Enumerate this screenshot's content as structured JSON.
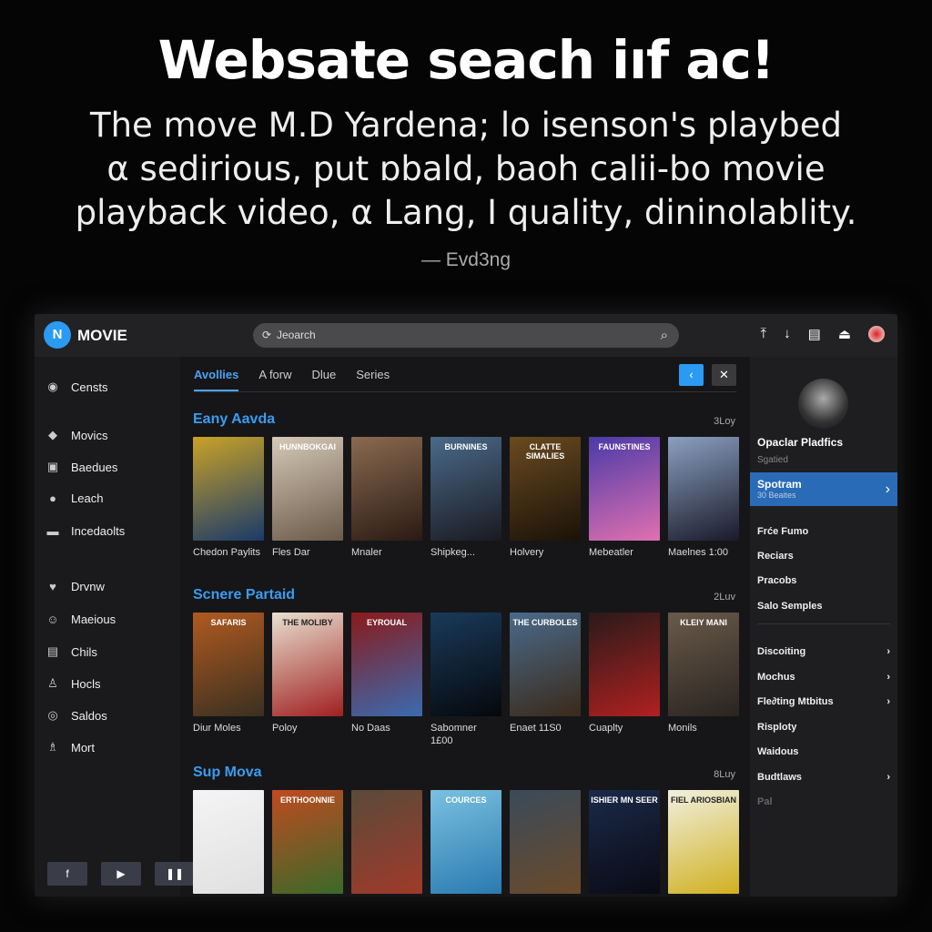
{
  "hero": {
    "title": "Websate seach iıf ac!",
    "subtitle": [
      "The move M.D Yardena; lo isenson's playbed",
      "α sedirious, put ɒbald, baoh calii-bo movie",
      "playback video, α Lang, I quality, dininolablity."
    ],
    "attribution": "— Evd3ng"
  },
  "header": {
    "logo": "N",
    "brand": "MOVIE",
    "search_placeholder": "Jeoarch",
    "icons": [
      "upload-icon",
      "download-icon",
      "list-icon",
      "cast-icon",
      "avatar"
    ]
  },
  "sidebar": {
    "items": [
      {
        "label": "Censts",
        "icon": "◉"
      },
      {
        "label": "Movics",
        "icon": "◆"
      },
      {
        "label": "Baedues",
        "icon": "▣"
      },
      {
        "label": "Leach",
        "icon": "●"
      },
      {
        "label": "Incedaolts",
        "icon": "▬"
      },
      {
        "label": "Drvnw",
        "icon": "♥"
      },
      {
        "label": "Maeious",
        "icon": "☺"
      },
      {
        "label": "Chils",
        "icon": "▤"
      },
      {
        "label": "Hocls",
        "icon": "♙"
      },
      {
        "label": "Saldos",
        "icon": "◎"
      },
      {
        "label": "Mort",
        "icon": "♗"
      }
    ],
    "buttons": [
      "f",
      "▶",
      "❚❚"
    ]
  },
  "tabs": [
    {
      "label": "Avollies",
      "active": true
    },
    {
      "label": "A forw"
    },
    {
      "label": "Dlue"
    },
    {
      "label": "Series"
    }
  ],
  "sections": [
    {
      "title": "Eany Aavda",
      "count": "3Loy",
      "movies": [
        {
          "caption": "Chedon Paylits",
          "poster": "",
          "colors": [
            "#c9a227",
            "#1a3a6a"
          ]
        },
        {
          "caption": "Fles Dar",
          "poster": "HUNNBOKGAI",
          "colors": [
            "#d6c9b8",
            "#6a5a48"
          ]
        },
        {
          "caption": "Mnaler",
          "poster": "",
          "colors": [
            "#8a6a50",
            "#2a1a14"
          ]
        },
        {
          "caption": "Shipkeg...",
          "poster": "BURNINES",
          "colors": [
            "#4a6a8a",
            "#1a1a20"
          ]
        },
        {
          "caption": "Holvery",
          "poster": "CLATTE SIMALIES",
          "colors": [
            "#6a4a20",
            "#1a1208"
          ]
        },
        {
          "caption": "Mebeatler",
          "poster": "FAUNSTINES",
          "colors": [
            "#4a3aa8",
            "#e070b0"
          ]
        },
        {
          "caption": "Maelnes 1:00",
          "poster": "",
          "colors": [
            "#8aa0c0",
            "#1a1a2a"
          ]
        }
      ]
    },
    {
      "title": "Scnere Partaid",
      "count": "2Luv",
      "movies": [
        {
          "caption": "Diur Moles",
          "poster": "SAFARIS",
          "colors": [
            "#b05a20",
            "#3a3020"
          ]
        },
        {
          "caption": "Poloy",
          "poster": "THE MOLIBY",
          "colors": [
            "#e8e0d0",
            "#a02020"
          ]
        },
        {
          "caption": "No Daas",
          "poster": "EYROUAL",
          "colors": [
            "#8a1a1a",
            "#3a6ab0"
          ]
        },
        {
          "caption": "Sabomner 1£00",
          "poster": "",
          "colors": [
            "#1a3a5a",
            "#05080c"
          ]
        },
        {
          "caption": "Enaet 11S0",
          "poster": "THE CURBOLES",
          "colors": [
            "#4a6a8a",
            "#3a2a1a"
          ]
        },
        {
          "caption": "Cuaplty",
          "poster": "",
          "colors": [
            "#2a1a1a",
            "#b02020"
          ]
        },
        {
          "caption": "Monils",
          "poster": "KLEIY MANI",
          "colors": [
            "#6a5a4a",
            "#2a2420"
          ]
        }
      ]
    },
    {
      "title": "Sup Mova",
      "count": "8Luy",
      "movies": [
        {
          "caption": "",
          "poster": "",
          "colors": [
            "#f4f4f4",
            "#e0e0e0"
          ]
        },
        {
          "caption": "",
          "poster": "ERTHOONNIE",
          "colors": [
            "#c04a20",
            "#3a6a2a"
          ]
        },
        {
          "caption": "",
          "poster": "",
          "colors": [
            "#5a4a3a",
            "#a03a2a"
          ]
        },
        {
          "caption": "",
          "poster": "COURCES",
          "colors": [
            "#7ac0e0",
            "#2a7ab0"
          ]
        },
        {
          "caption": "",
          "poster": "",
          "colors": [
            "#3a4a5a",
            "#6a4a2a"
          ]
        },
        {
          "caption": "",
          "poster": "ISHIER MN SEER",
          "colors": [
            "#1a2a4a",
            "#0a0a14"
          ]
        },
        {
          "caption": "",
          "poster": "FIEL ARIOSBIAN",
          "colors": [
            "#f0f0e0",
            "#d0b020"
          ]
        }
      ]
    }
  ],
  "right_panel": {
    "name": "Opaclar Pladfics",
    "sub": "Sgatied",
    "selected": {
      "title": "Spotram",
      "sub": "30 Beaites"
    },
    "items": [
      "Frće Fumo",
      "Reciars",
      "Pracobs",
      "Salo Semples"
    ],
    "items2": [
      {
        "label": "Discoiting",
        "chevron": true
      },
      {
        "label": "Mochus",
        "chevron": true
      },
      {
        "label": "Fle∂ting Mtbitus",
        "chevron": true
      },
      {
        "label": "Risploty",
        "chevron": false
      },
      {
        "label": "Waidous",
        "chevron": false
      },
      {
        "label": "Budtlaws",
        "chevron": true
      },
      {
        "label": "Pal",
        "chevron": false
      }
    ]
  },
  "colors": {
    "accent": "#2b9af3",
    "selected": "#2a6bb8"
  }
}
